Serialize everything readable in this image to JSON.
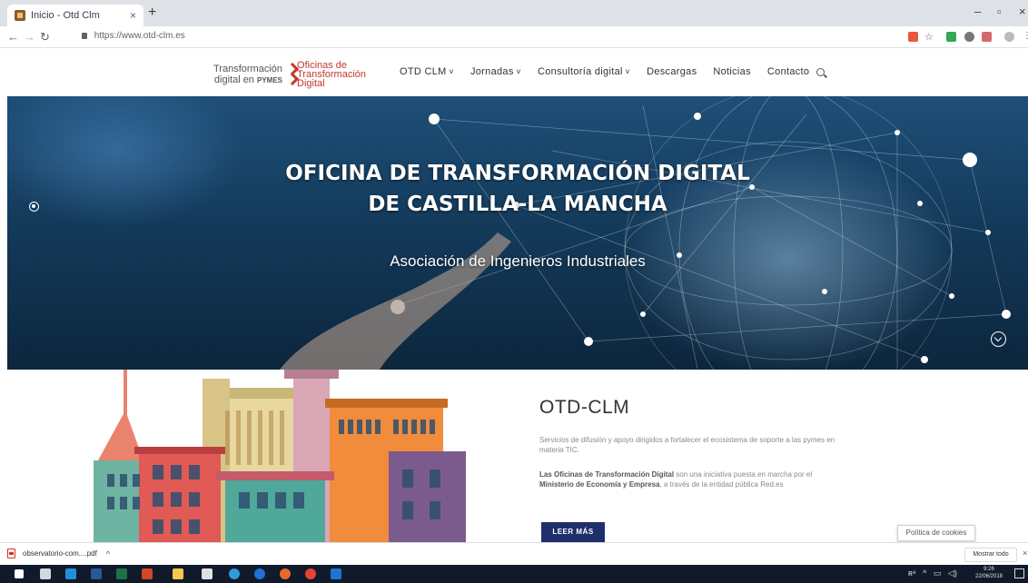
{
  "browser": {
    "tab_title": "Inicio - Otd Clm",
    "tab_close": "×",
    "new_tab": "+",
    "url": "https://www.otd-clm.es",
    "window_controls": [
      "–",
      "▫",
      "×"
    ]
  },
  "site": {
    "logo": {
      "line1a": "Transformación",
      "line1b_prefix": "digital en",
      "line1b_bold": "PYMES",
      "line2a": "Oficinas de",
      "line2b": "Transformación",
      "line2c": "Digital"
    },
    "nav": [
      {
        "label": "OTD CLM",
        "dropdown": true
      },
      {
        "label": "Jornadas",
        "dropdown": true
      },
      {
        "label": "Consultoría digital",
        "dropdown": true
      },
      {
        "label": "Descargas",
        "dropdown": false
      },
      {
        "label": "Noticias",
        "dropdown": false
      },
      {
        "label": "Contacto",
        "dropdown": false
      }
    ],
    "hero": {
      "title_line1": "OFICINA DE TRANSFORMACIÓN DIGITAL",
      "title_line2": "DE CASTILLA-LA MANCHA",
      "subtitle": "Asociación de Ingenieros Industriales"
    },
    "about": {
      "title": "OTD-CLM",
      "p1": "Servicios de difusión y apoyo dirigidos a fortalecer el ecosistema de soporte a las pymes en materia TIC.",
      "p2_bold1": "Las Oficinas de Transformación Digital",
      "p2_text1": " son una iniciativa puesta en marcha por el ",
      "p2_bold2": "Ministerio de Economía y Empresa",
      "p2_text2": ", a través de la entidad pública Red.es",
      "button": "LEER MÁS"
    },
    "cookies": "Política de cookies"
  },
  "downloads": {
    "file": "observatorio-com....pdf",
    "caret": "^",
    "show_all": "Mostrar todo",
    "close": "×"
  },
  "taskbar": {
    "time": "9:26",
    "date": "22/06/2018"
  },
  "colors": {
    "accent_red": "#c0392b",
    "button_navy": "#1f2f6b",
    "taskbar": "#101a2b"
  }
}
